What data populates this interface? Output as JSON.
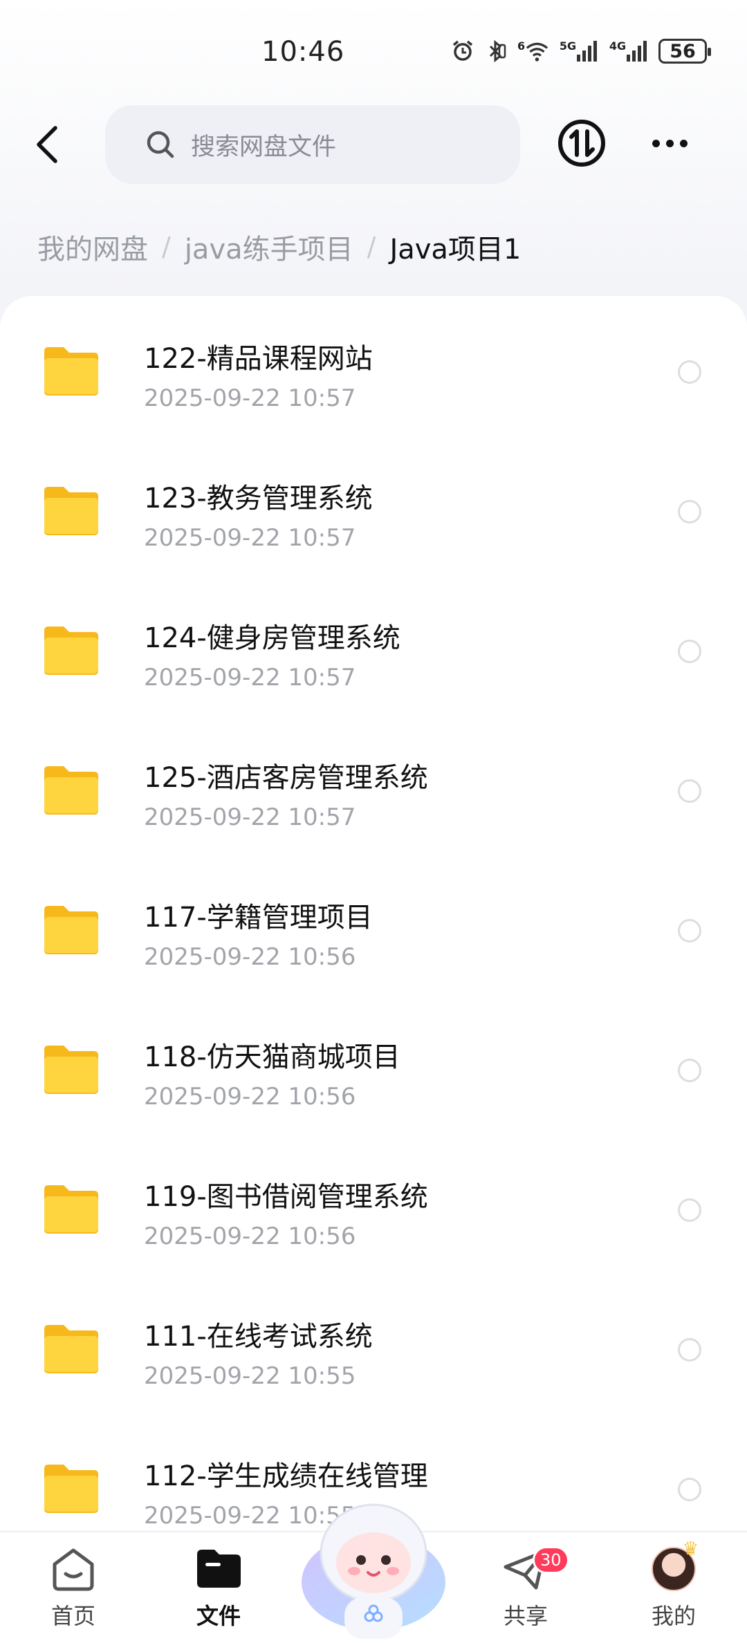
{
  "status_bar": {
    "time": "10:46",
    "battery": "56",
    "sig1": "5G",
    "sig2": "4G",
    "wifi_sup": "6"
  },
  "header": {
    "search_placeholder": "搜索网盘文件"
  },
  "breadcrumb": [
    "我的网盘",
    "java练手项目",
    "Java项目1"
  ],
  "files": [
    {
      "name": "122-精品课程网站",
      "date": "2025-09-22  10:57"
    },
    {
      "name": "123-教务管理系统",
      "date": "2025-09-22  10:57"
    },
    {
      "name": "124-健身房管理系统",
      "date": "2025-09-22  10:57"
    },
    {
      "name": "125-酒店客房管理系统",
      "date": "2025-09-22  10:57"
    },
    {
      "name": "117-学籍管理项目",
      "date": "2025-09-22  10:56"
    },
    {
      "name": "118-仿天猫商城项目",
      "date": "2025-09-22  10:56"
    },
    {
      "name": "119-图书借阅管理系统",
      "date": "2025-09-22  10:56"
    },
    {
      "name": "111-在线考试系统",
      "date": "2025-09-22  10:55"
    },
    {
      "name": "112-学生成绩在线管理",
      "date": "2025-09-22  10:55"
    }
  ],
  "nav": {
    "home": "首页",
    "files": "文件",
    "share": "共享",
    "share_badge": "30",
    "mine": "我的"
  },
  "colors": {
    "folder": "#FFCC33",
    "badge": "#FF3B5C",
    "search_bg": "#EEF0F5"
  }
}
